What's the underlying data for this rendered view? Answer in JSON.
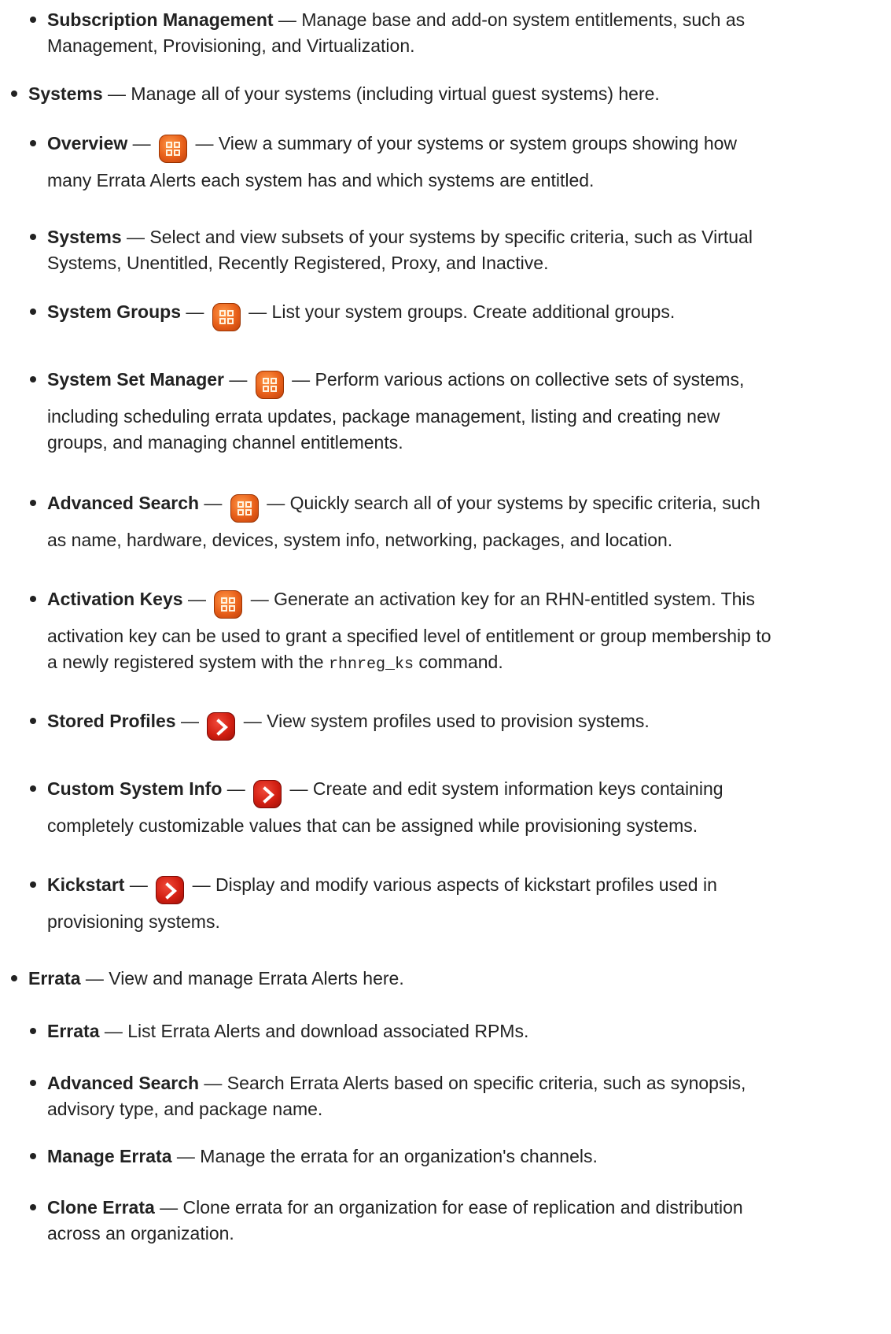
{
  "sections": {
    "subscription": {
      "term": "Subscription Management",
      "desc_line1": " — Manage base and add-on system entitlements, such as",
      "desc_line2": "Management, Provisioning, and Virtualization."
    },
    "systems": {
      "term": "Systems",
      "desc": " — Manage all of your systems (including virtual guest systems) here.",
      "items": {
        "overview": {
          "term": "Overview",
          "dash": " — ",
          "icon": "grid-icon",
          "desc_line1": " — View a summary of your systems or system groups showing how",
          "desc_line2": "many Errata Alerts each system has and which systems are entitled."
        },
        "systems": {
          "term": "Systems",
          "desc_line1": " — Select and view subsets of your systems by specific criteria, such as Virtual",
          "desc_line2": "Systems, Unentitled, Recently Registered, Proxy, and Inactive."
        },
        "groups": {
          "term": "System Groups",
          "dash": " — ",
          "icon": "grid-icon",
          "desc_line1": " — List your system groups. Create additional groups."
        },
        "ssm": {
          "term": "System Set Manager",
          "dash": " — ",
          "icon": "grid-icon",
          "desc_line1": " — Perform various actions on collective sets of systems,",
          "desc_line2": "including scheduling errata updates, package management, listing and creating new",
          "desc_line3": "groups, and managing channel entitlements."
        },
        "advsearch": {
          "term": "Advanced Search",
          "dash": " — ",
          "icon": "grid-icon",
          "desc_line1": " — Quickly search all of your systems by specific criteria, such",
          "desc_line2": "as name, hardware, devices, system info, networking, packages, and location."
        },
        "actkeys": {
          "term": "Activation Keys",
          "dash": " — ",
          "icon": "grid-icon",
          "desc_line1": " — Generate an activation key for an RHN-entitled system. This",
          "desc_line2": "activation key can be used to grant a specified level of entitlement or group membership to",
          "desc_line3a": "a newly registered system with the ",
          "desc_line3_code": "rhnreg_ks",
          "desc_line3b": " command."
        },
        "stored": {
          "term": "Stored Profiles",
          "dash": " — ",
          "icon": "arrow-icon",
          "desc_line1": " — View system profiles used to provision systems."
        },
        "custom": {
          "term": "Custom System Info",
          "dash": " — ",
          "icon": "arrow-icon",
          "desc_line1": " — Create and edit system information keys containing",
          "desc_line2": "completely customizable values that can be assigned while provisioning systems."
        },
        "kickstart": {
          "term": "Kickstart",
          "dash": " — ",
          "icon": "arrow-icon",
          "desc_line1": " — Display and modify various aspects of kickstart profiles used in",
          "desc_line2": "provisioning systems."
        }
      }
    },
    "errata": {
      "term": "Errata",
      "desc": " — View and manage Errata Alerts here.",
      "items": {
        "errata": {
          "term": "Errata",
          "desc_line1": " — List Errata Alerts and download associated RPMs."
        },
        "advsearch": {
          "term": "Advanced Search",
          "desc_line1": " — Search Errata Alerts based on specific criteria, such as synopsis,",
          "desc_line2": "advisory type, and package name."
        },
        "manage": {
          "term": "Manage Errata",
          "desc_line1": " — Manage the errata for an organization's channels."
        },
        "clone": {
          "term": "Clone Errata",
          "desc_line1": " — Clone errata for an organization for ease of replication and distribution",
          "desc_line2": "across an organization."
        }
      }
    }
  },
  "colors": {
    "text": "#222222",
    "grid_icon": "#e8601a",
    "arrow_icon": "#d21f12"
  }
}
